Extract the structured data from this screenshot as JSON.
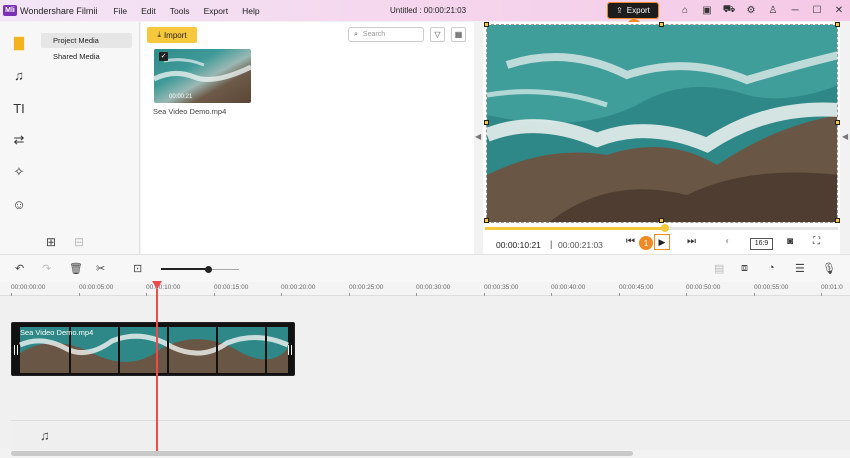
{
  "app": {
    "logo": "Mli",
    "name": "Wondershare Filmii"
  },
  "menu": [
    "File",
    "Edit",
    "Tools",
    "Export",
    "Help"
  ],
  "document": {
    "title": "Untitled :  00:00:21:03"
  },
  "export": {
    "label": "Export",
    "icon": "upload-icon",
    "step": "2"
  },
  "window_controls": [
    "home-icon",
    "save-icon",
    "cart-icon",
    "settings-icon",
    "shirt-icon",
    "minimize-icon",
    "maximize-icon",
    "close-icon"
  ],
  "left_icons": [
    "folder-icon",
    "music-icon",
    "text-icon",
    "transition-icon",
    "effects-icon",
    "sticker-icon"
  ],
  "media_nav": {
    "project_media": "Project Media",
    "shared_media": "Shared Media"
  },
  "library": {
    "import_label": "Import",
    "search_placeholder": "Search",
    "clip": {
      "name": "Sea Video Demo.mp4",
      "duration": "00:00:21"
    }
  },
  "preview": {
    "current_time": "00:00:10:21",
    "total_time": "00:00:21:03",
    "ratio": "16:9",
    "play_step": "1",
    "progress_fraction": 0.51
  },
  "timeline": {
    "zoom_fraction": 0.6,
    "ruler": [
      "00:00:00:00",
      "00:00:05:00",
      "00:00:10:00",
      "00:00:15:00",
      "00:00:20:00",
      "00:00:25:00",
      "00:00:30:00",
      "00:00:35:00",
      "00:00:40:00",
      "00:00:45:00",
      "00:00:50:00",
      "00:00:55:00",
      "00:01:0"
    ],
    "clip_label": "Sea Video Demo.mp4"
  },
  "colors": {
    "accent": "#f8c83c",
    "highlight": "#f08a24",
    "playhead": "#ee4a4a"
  }
}
